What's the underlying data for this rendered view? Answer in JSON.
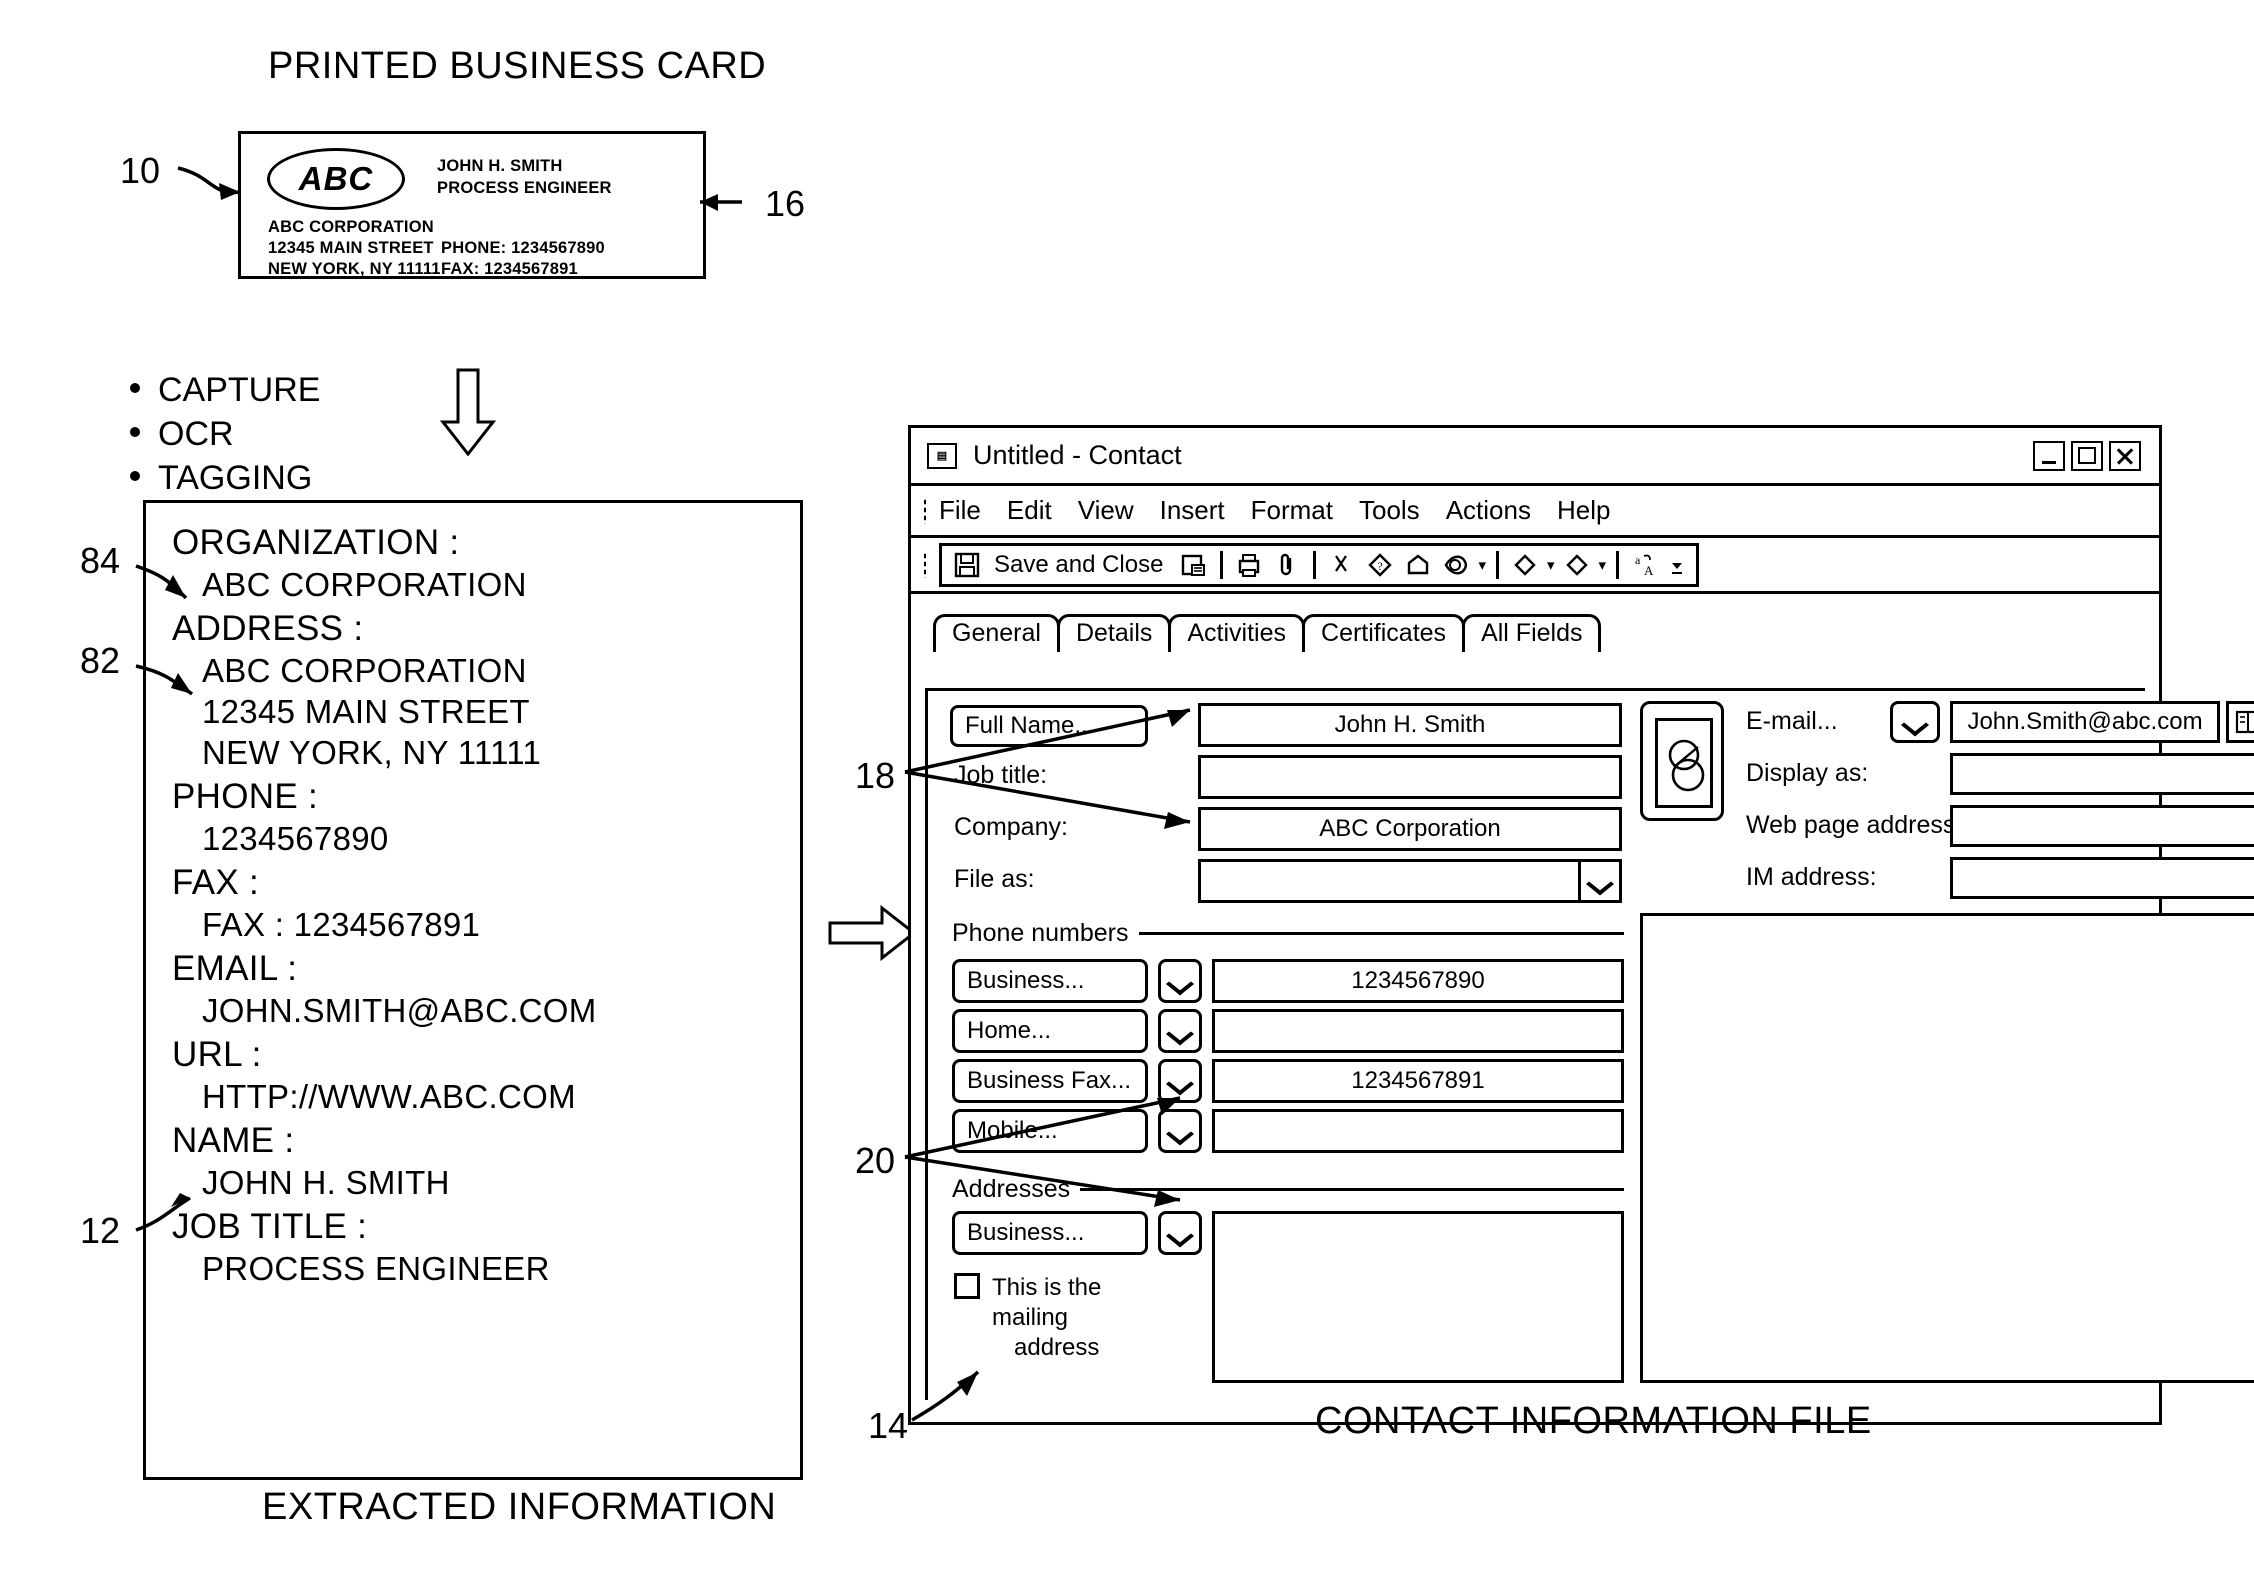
{
  "figure": {
    "card_caption": "PRINTED BUSINESS CARD",
    "extracted_caption": "EXTRACTED INFORMATION",
    "contact_caption": "CONTACT INFORMATION FILE"
  },
  "reference_numerals": {
    "card": "10",
    "name_title_block": "16",
    "extracted_url": "12",
    "contact_window": "14",
    "name_fields": "18",
    "addresses_group": "20",
    "address_entry": "82",
    "organization_entry": "84"
  },
  "business_card": {
    "logo_text": "ABC",
    "person_name": "JOHN H. SMITH",
    "person_title": "PROCESS ENGINEER",
    "company": "ABC CORPORATION",
    "street": "12345 MAIN STREET",
    "city_state_zip": "NEW YORK, NY 11111",
    "phone": "PHONE: 1234567890",
    "fax": "FAX: 1234567891"
  },
  "process_steps": [
    "CAPTURE",
    "OCR",
    "TAGGING"
  ],
  "extracted_information": [
    {
      "key": "ORGANIZATION :",
      "values": [
        "ABC CORPORATION"
      ]
    },
    {
      "key": "ADDRESS :",
      "values": [
        "ABC CORPORATION",
        "12345 MAIN STREET",
        "NEW YORK, NY 11111"
      ]
    },
    {
      "key": "PHONE :",
      "values": [
        "1234567890"
      ]
    },
    {
      "key": "FAX :",
      "values": [
        "FAX : 1234567891"
      ]
    },
    {
      "key": "EMAIL :",
      "values": [
        "JOHN.SMITH@ABC.COM"
      ]
    },
    {
      "key": "URL :",
      "values": [
        "HTTP://WWW.ABC.COM"
      ]
    },
    {
      "key": "NAME :",
      "values": [
        "JOHN H. SMITH"
      ]
    },
    {
      "key": "JOB TITLE :",
      "values": [
        "PROCESS ENGINEER"
      ]
    }
  ],
  "contact_window": {
    "title": "Untitled - Contact",
    "title_icon": "contact-card-icon",
    "window_buttons": [
      "minimize-icon",
      "maximize-icon",
      "close-icon"
    ],
    "menus": [
      "File",
      "Edit",
      "View",
      "Insert",
      "Format",
      "Tools",
      "Actions",
      "Help"
    ],
    "toolbar": {
      "save_and_close": "Save and Close",
      "icons": [
        "save-icon",
        "print-icon",
        "attach-icon",
        "cut-icon",
        "check-names-icon",
        "flag-icon",
        "categorize-icon",
        "previous-item-icon",
        "next-item-icon",
        "spelling-icon"
      ]
    },
    "tabs": [
      {
        "label": "General",
        "active": true
      },
      {
        "label": "Details",
        "active": false
      },
      {
        "label": "Activities",
        "active": false
      },
      {
        "label": "Certificates",
        "active": false
      },
      {
        "label": "All Fields",
        "active": false
      }
    ],
    "general": {
      "full_name_button": "Full Name...",
      "full_name_value": "John H. Smith",
      "job_title_label": "Job title:",
      "job_title_value": "",
      "company_label": "Company:",
      "company_value": "ABC Corporation",
      "file_as_label": "File as:",
      "file_as_value": "",
      "email_button": "E-mail...",
      "email_value": "John.Smith@abc.com",
      "display_as_label": "Display as:",
      "display_as_value": "",
      "web_page_label": "Web page address:",
      "web_page_value": "",
      "im_address_label": "IM address:",
      "im_address_value": "",
      "photo_placeholder": "contact-photo-icon",
      "address_book_icon": "address-book-icon",
      "phone_group_legend": "Phone numbers",
      "phones": [
        {
          "label": "Business...",
          "value": "1234567890"
        },
        {
          "label": "Home...",
          "value": ""
        },
        {
          "label": "Business Fax...",
          "value": "1234567891"
        },
        {
          "label": "Mobile...",
          "value": ""
        }
      ],
      "addresses_group_legend": "Addresses",
      "address_type": "Business...",
      "address_value": "",
      "mailing_checkbox_label_line1": "This is the mailing",
      "mailing_checkbox_label_line2": "address",
      "mailing_checkbox_checked": false,
      "notes_value": ""
    }
  },
  "colors": {
    "ink": "#000000",
    "paper": "#ffffff"
  }
}
